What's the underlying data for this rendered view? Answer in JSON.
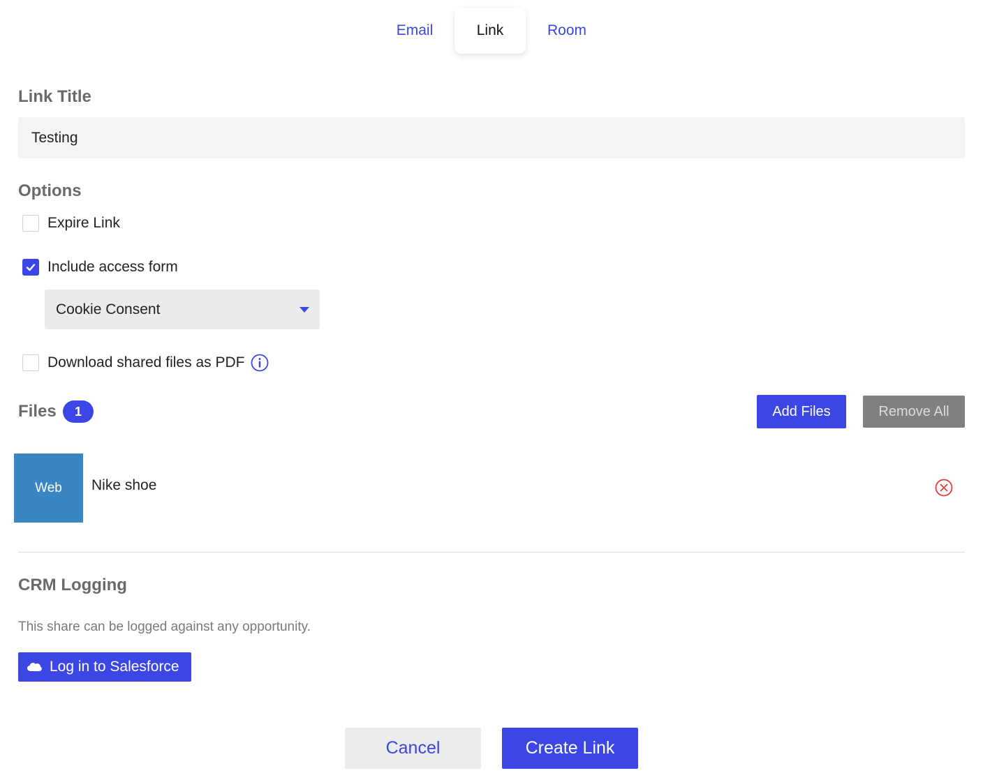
{
  "tabs": [
    {
      "label": "Email",
      "active": false
    },
    {
      "label": "Link",
      "active": true
    },
    {
      "label": "Room",
      "active": false
    }
  ],
  "link_title": {
    "label": "Link Title",
    "value": "Testing"
  },
  "options": {
    "label": "Options",
    "expire_link": {
      "label": "Expire Link",
      "checked": false
    },
    "include_access_form": {
      "label": "Include access form",
      "checked": true
    },
    "access_form_select": {
      "value": "Cookie Consent"
    },
    "download_as_pdf": {
      "label": "Download shared files as PDF",
      "checked": false,
      "icon": "info-icon"
    }
  },
  "files": {
    "label": "Files",
    "count": "1",
    "add_label": "Add Files",
    "remove_all_label": "Remove All",
    "items": [
      {
        "thumb_label": "Web",
        "name": "Nike shoe",
        "thumb_color": "#3a86c2"
      }
    ]
  },
  "crm": {
    "label": "CRM Logging",
    "description": "This share can be logged against any opportunity.",
    "salesforce_button": "Log in to Salesforce",
    "icon": "salesforce-cloud-icon"
  },
  "footer": {
    "cancel_label": "Cancel",
    "create_label": "Create Link"
  },
  "colors": {
    "accent": "#3b46e4",
    "link_text": "#3a46e0",
    "danger": "#e0403a",
    "disabled_button": "#808080"
  }
}
